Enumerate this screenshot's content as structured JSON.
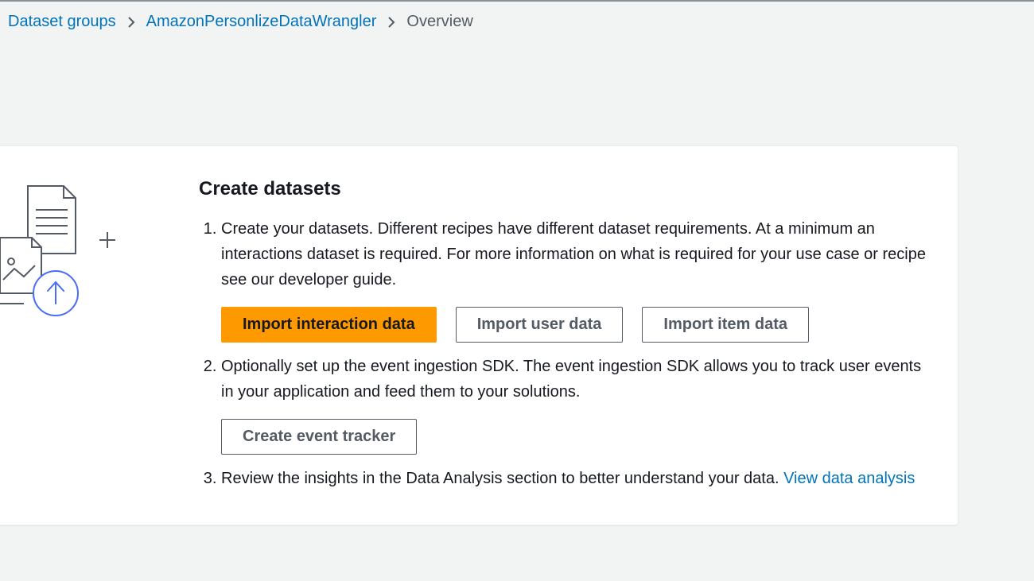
{
  "breadcrumb": {
    "root": "Dataset groups",
    "group": "AmazonPersonlizeDataWrangler",
    "current": "Overview"
  },
  "card": {
    "title": "Create datasets",
    "steps": {
      "one": "Create your datasets. Different recipes have different dataset requirements. At a minimum an interactions dataset is required. For more information on what is required for your use case or recipe see our developer guide.",
      "two": "Optionally set up the event ingestion SDK. The event ingestion SDK allows you to track user events in your application and feed them to your solutions.",
      "three_prefix": "Review the insights in the Data Analysis section to better understand your data. ",
      "three_link": "View data analysis"
    },
    "buttons": {
      "import_interaction": "Import interaction data",
      "import_user": "Import user data",
      "import_item": "Import item data",
      "create_event_tracker": "Create event tracker"
    }
  }
}
